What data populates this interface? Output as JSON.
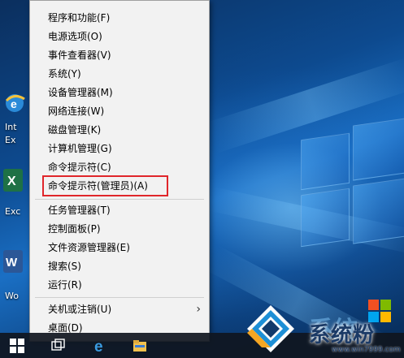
{
  "menu": {
    "items": [
      {
        "label": "程序和功能(F)"
      },
      {
        "label": "电源选项(O)"
      },
      {
        "label": "事件查看器(V)"
      },
      {
        "label": "系统(Y)"
      },
      {
        "label": "设备管理器(M)"
      },
      {
        "label": "网络连接(W)"
      },
      {
        "label": "磁盘管理(K)"
      },
      {
        "label": "计算机管理(G)"
      },
      {
        "label": "命令提示符(C)"
      },
      {
        "label": "命令提示符(管理员)(A)"
      },
      {
        "label": "任务管理器(T)"
      },
      {
        "label": "控制面板(P)"
      },
      {
        "label": "文件资源管理器(E)"
      },
      {
        "label": "搜索(S)"
      },
      {
        "label": "运行(R)"
      },
      {
        "label": "关机或注销(U)",
        "submenu": true
      },
      {
        "label": "桌面(D)"
      }
    ],
    "highlighted_item": "命令提示符(管理员)(A)",
    "highlight_color": "#e0262b"
  },
  "desktop": {
    "icons": [
      {
        "name": "internet-explorer-icon",
        "label": "Int"
      },
      {
        "name": "excel-icon",
        "label": "Exc"
      },
      {
        "name": "word-icon",
        "label": "Wo"
      }
    ],
    "partial_labels": [
      "Ex"
    ]
  },
  "taskbar": {
    "icons": [
      "start-icon",
      "task-view-icon",
      "edge-icon",
      "file-explorer-icon"
    ]
  },
  "watermark": {
    "brand": "系统粉",
    "brand_ghost": "系统",
    "url": "www.win7999.com"
  },
  "colors": {
    "accent": "#0a4c8c",
    "menu_bg": "#f2f2f2",
    "highlight": "#e0262b"
  }
}
